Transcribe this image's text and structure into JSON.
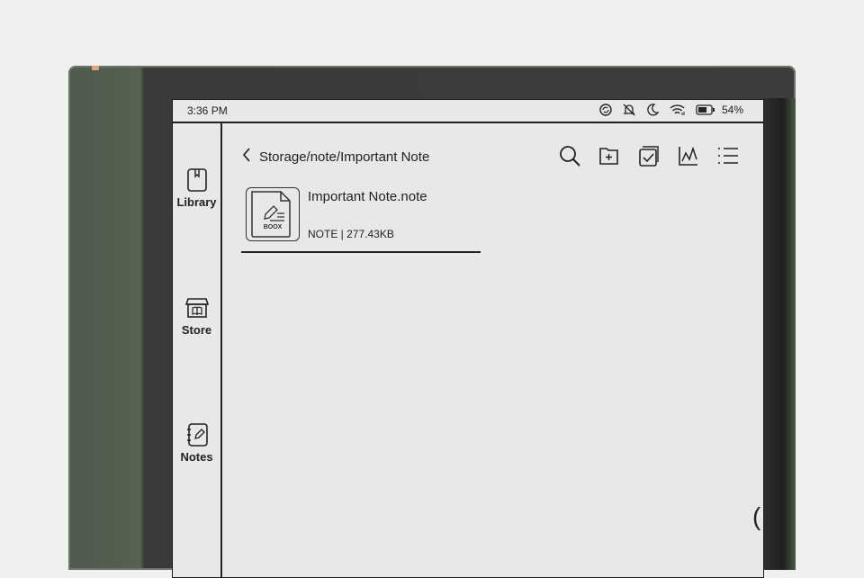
{
  "status_bar": {
    "time": "3:36 PM",
    "battery": "54%",
    "icons": [
      "sync-icon",
      "bell-off-icon",
      "moon-icon",
      "wifi-icon",
      "battery-icon"
    ]
  },
  "sidebar": {
    "items": [
      {
        "label": "Library",
        "icon": "book-icon"
      },
      {
        "label": "Store",
        "icon": "store-icon"
      },
      {
        "label": "Notes",
        "icon": "notebook-icon"
      }
    ]
  },
  "main": {
    "breadcrumb": "Storage/note/Important Note",
    "toolbar": [
      "search-icon",
      "new-folder-icon",
      "select-icon",
      "stats-icon",
      "list-view-icon"
    ],
    "files": [
      {
        "name": "Important Note.note",
        "meta": "NOTE | 277.43KB",
        "thumb_label": "BOOX"
      }
    ]
  },
  "colors": {
    "screen": "#e8e8e8",
    "ink": "#222222",
    "device_green": "#56614f",
    "accent": "#e3a07a"
  }
}
